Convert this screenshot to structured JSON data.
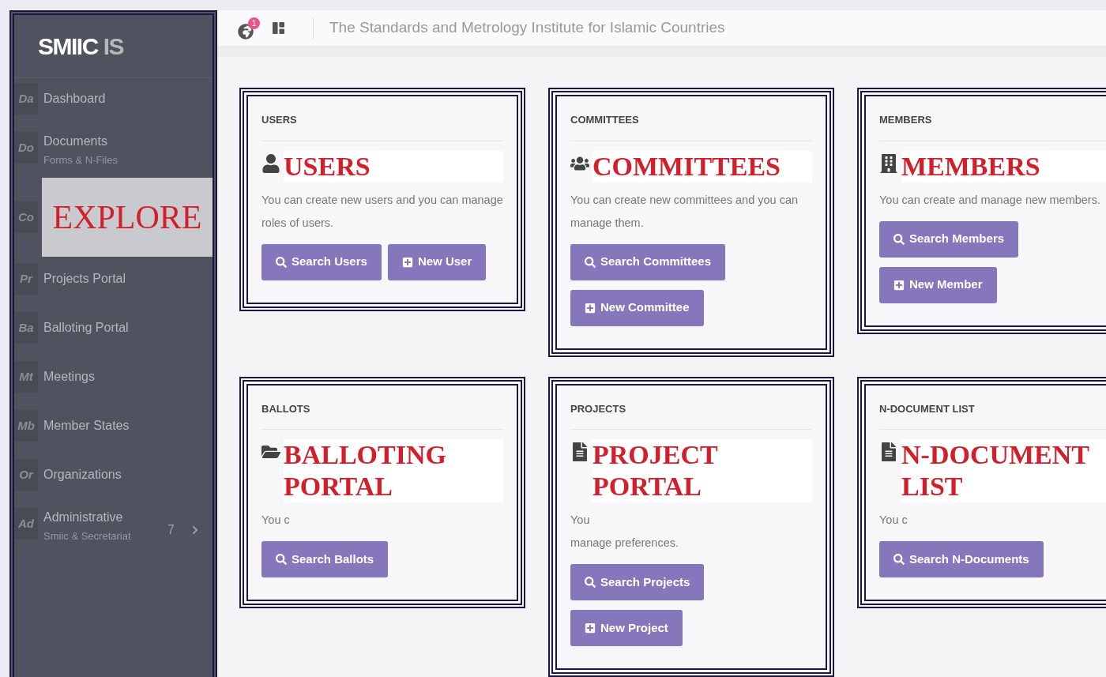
{
  "sidebar": {
    "logo": {
      "primary": "SMIIC",
      "secondary": "IS"
    },
    "items": [
      {
        "abbr": "Da",
        "label": "Dashboard",
        "kind": "single"
      },
      {
        "abbr": "Do",
        "label": "Documents",
        "sublabel": "Forms & N-Files",
        "kind": "single"
      },
      {
        "abbr": "Co",
        "kind": "covered"
      },
      {
        "abbr": "Pr",
        "label": "Projects Portal",
        "kind": "single"
      },
      {
        "abbr": "Ba",
        "label": "Balloting Portal",
        "kind": "single"
      },
      {
        "abbr": "Mt",
        "label": "Meetings",
        "kind": "single"
      },
      {
        "abbr": "Mb",
        "label": "Member States",
        "kind": "single"
      },
      {
        "abbr": "Or",
        "label": "Organizations",
        "kind": "single"
      },
      {
        "abbr": "Ad",
        "label": "Administrative",
        "sublabel": "Smiic & Secretariat",
        "count": "7",
        "kind": "group"
      }
    ],
    "overlay": "EXPLORE"
  },
  "header": {
    "notification_count": "1",
    "title": "The Standards and Metrology Institute for Islamic Countries"
  },
  "cards": [
    {
      "title": "USERS",
      "kind": "user",
      "heading": "USERS",
      "description": [
        "You can create new users and you can manage roles of users."
      ],
      "buttons": [
        {
          "label": "Search Users",
          "kind": "search"
        },
        {
          "label": "New User",
          "kind": "new"
        }
      ]
    },
    {
      "title": "COMMITTEES",
      "kind": "group",
      "heading": "COMMITTEES",
      "description": [
        "You can create new committees and you can manage them."
      ],
      "buttons": [
        {
          "label": "Search Committees",
          "kind": "search"
        },
        {
          "label": "New Committee",
          "kind": "new"
        }
      ]
    },
    {
      "title": "MEMBERS",
      "kind": "building",
      "heading": "MEMBERS",
      "description": [
        "You can create and manage new members."
      ],
      "buttons": [
        {
          "label": "Search Members",
          "kind": "search"
        },
        {
          "label": "New Member",
          "kind": "new"
        }
      ]
    },
    {
      "title": "BALLOTS",
      "kind": "folder",
      "heading": "BALLOTING PORTAL",
      "description": [
        "You c"
      ],
      "buttons": [
        {
          "label": "Search Ballots",
          "kind": "search"
        }
      ]
    },
    {
      "title": "PROJECTS",
      "kind": "file",
      "heading": "PROJECT PORTAL",
      "description": [
        "You",
        "manage preferences."
      ],
      "buttons": [
        {
          "label": "Search Projects",
          "kind": "search"
        },
        {
          "label": "New Project",
          "kind": "new"
        }
      ]
    },
    {
      "title": "N-DOCUMENT LIST",
      "kind": "file",
      "heading": "N-DOCUMENT LIST",
      "description": [
        "You c"
      ],
      "buttons": [
        {
          "label": "Search N-Documents",
          "kind": "search"
        }
      ]
    }
  ]
}
